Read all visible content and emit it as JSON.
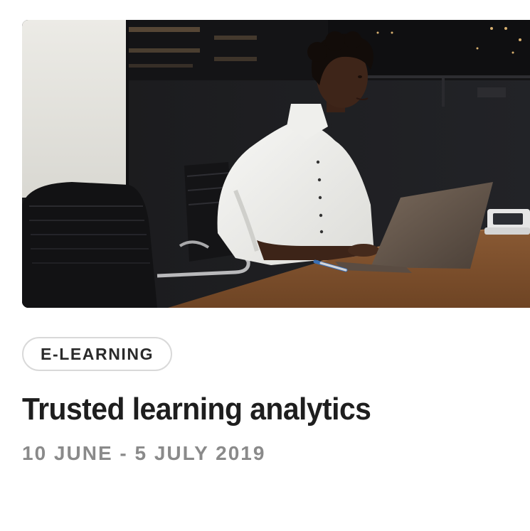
{
  "card": {
    "category": "E-LEARNING",
    "title": "Trusted learning analytics",
    "dates": "10 JUNE - 5 JULY 2019"
  },
  "colors": {
    "title": "#1e1e1e",
    "dates": "#8a8a8a",
    "tag_border": "#d9d9d9",
    "tag_text": "#2a2a2a"
  }
}
